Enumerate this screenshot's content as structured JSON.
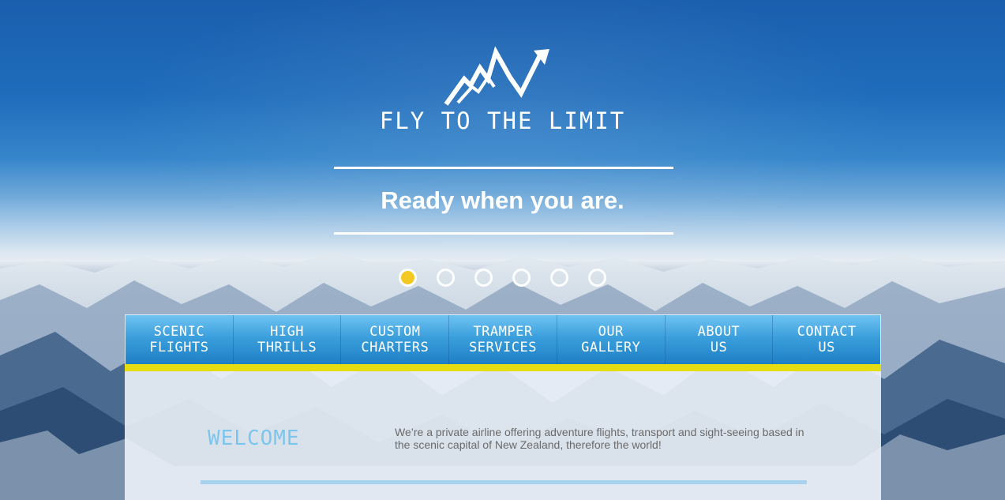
{
  "brand": {
    "logo_icon": "mountain-arrow-icon",
    "name": "FLY TO THE LIMIT",
    "tagline": "Ready when you are."
  },
  "slider": {
    "slide_count": 6,
    "active_index": 0,
    "active_color": "#f4c823"
  },
  "nav": {
    "items": [
      {
        "label": "SCENIC\nFLIGHTS"
      },
      {
        "label": "HIGH\nTHRILLS"
      },
      {
        "label": "CUSTOM\nCHARTERS"
      },
      {
        "label": "TRAMPER\nSERVICES"
      },
      {
        "label": "OUR\nGALLERY"
      },
      {
        "label": "ABOUT\nUS"
      },
      {
        "label": "CONTACT\nUS"
      }
    ],
    "accent_color": "#e6dc12"
  },
  "welcome": {
    "heading": "WELCOME",
    "text": "We’re a private airline offering adventure flights, transport and sight-seeing based in the scenic capital of New Zealand, therefore the world!"
  },
  "colors": {
    "sky": "#1f6cbb",
    "nav_blue": "#3b9fdc",
    "heading_blue": "#7cc6ee"
  }
}
